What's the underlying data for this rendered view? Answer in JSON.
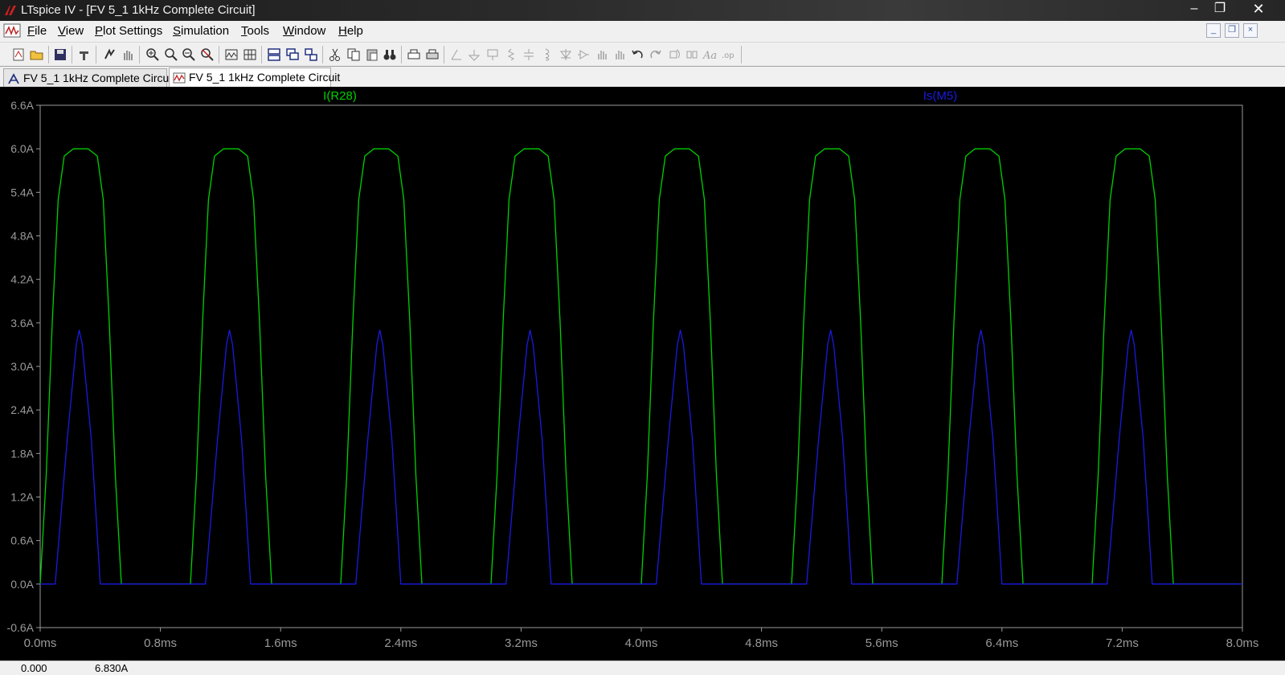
{
  "window": {
    "title": "LTspice IV - [FV 5_1 1kHz Complete Circuit]",
    "controls": {
      "minimize": "–",
      "maximize": "❐",
      "close": "✕"
    }
  },
  "menu": {
    "items": [
      {
        "label": "File",
        "underline": "F",
        "rest": "ile"
      },
      {
        "label": "View",
        "underline": "V",
        "rest": "iew"
      },
      {
        "label": "Plot Settings",
        "underline": "P",
        "rest": "lot Settings"
      },
      {
        "label": "Simulation",
        "underline": "S",
        "rest": "imulation"
      },
      {
        "label": "Tools",
        "underline": "T",
        "rest": "ools"
      },
      {
        "label": "Window",
        "underline": "W",
        "rest": "indow"
      },
      {
        "label": "Help",
        "underline": "H",
        "rest": "elp"
      }
    ],
    "mdi": {
      "minimize": "_",
      "restore": "❐",
      "close": "×"
    }
  },
  "toolbar": {
    "buttons": [
      "new-schematic",
      "open",
      "save",
      "control-panel",
      "run",
      "halt",
      "zoom-in",
      "zoom-out",
      "zoom-back",
      "zoom-fit",
      "autorange",
      "mark-unused",
      "tile-horizontal",
      "cascade",
      "tile-vertical",
      "cut",
      "copy",
      "paste",
      "find",
      "print-preview",
      "print",
      "wire",
      "ground",
      "label-net",
      "resistor",
      "capacitor",
      "inductor",
      "diode",
      "component",
      "move",
      "drag",
      "undo",
      "redo",
      "rotate",
      "mirror",
      "text",
      "spice-directive"
    ]
  },
  "tabs": [
    {
      "label": "FV 5_1 1kHz Complete Circuit",
      "kind": "schematic"
    },
    {
      "label": "FV 5_1 1kHz Complete Circuit",
      "kind": "waveform"
    }
  ],
  "chart_data": {
    "type": "line",
    "background": "#000000",
    "title": "",
    "xlabel": "",
    "ylabel": "",
    "xlim": [
      0,
      8.0
    ],
    "ylim": [
      -0.6,
      6.6
    ],
    "x_ticks": [
      "0.0ms",
      "0.8ms",
      "1.6ms",
      "2.4ms",
      "3.2ms",
      "4.0ms",
      "4.8ms",
      "5.6ms",
      "6.4ms",
      "7.2ms",
      "8.0ms"
    ],
    "y_ticks": [
      "6.6A",
      "6.0A",
      "5.4A",
      "4.8A",
      "4.2A",
      "3.6A",
      "3.0A",
      "2.4A",
      "1.8A",
      "1.2A",
      "0.6A",
      "0.0A",
      "-0.6A"
    ],
    "grid": false,
    "period_ms": 1.0,
    "series": [
      {
        "name": "I(R28)",
        "color": "#00d000",
        "shape": "flat-topped pulse each period",
        "points_one_period": [
          [
            0.0,
            0.0
          ],
          [
            0.04,
            1.5
          ],
          [
            0.08,
            3.6
          ],
          [
            0.12,
            5.3
          ],
          [
            0.16,
            5.9
          ],
          [
            0.22,
            6.0
          ],
          [
            0.32,
            6.0
          ],
          [
            0.38,
            5.9
          ],
          [
            0.42,
            5.3
          ],
          [
            0.46,
            3.6
          ],
          [
            0.5,
            1.5
          ],
          [
            0.54,
            0.0
          ],
          [
            1.0,
            0.0
          ]
        ],
        "peak": 6.0
      },
      {
        "name": "Is(M5)",
        "color": "#1a1ae0",
        "shape": "triangular pulse each period",
        "points_one_period": [
          [
            0.0,
            0.0
          ],
          [
            0.1,
            0.0
          ],
          [
            0.18,
            2.0
          ],
          [
            0.24,
            3.3
          ],
          [
            0.26,
            3.5
          ],
          [
            0.28,
            3.3
          ],
          [
            0.34,
            2.0
          ],
          [
            0.4,
            0.0
          ],
          [
            1.0,
            0.0
          ]
        ],
        "peak": 3.5
      }
    ]
  },
  "status": {
    "left": "0.000",
    "right": "6.830A"
  }
}
